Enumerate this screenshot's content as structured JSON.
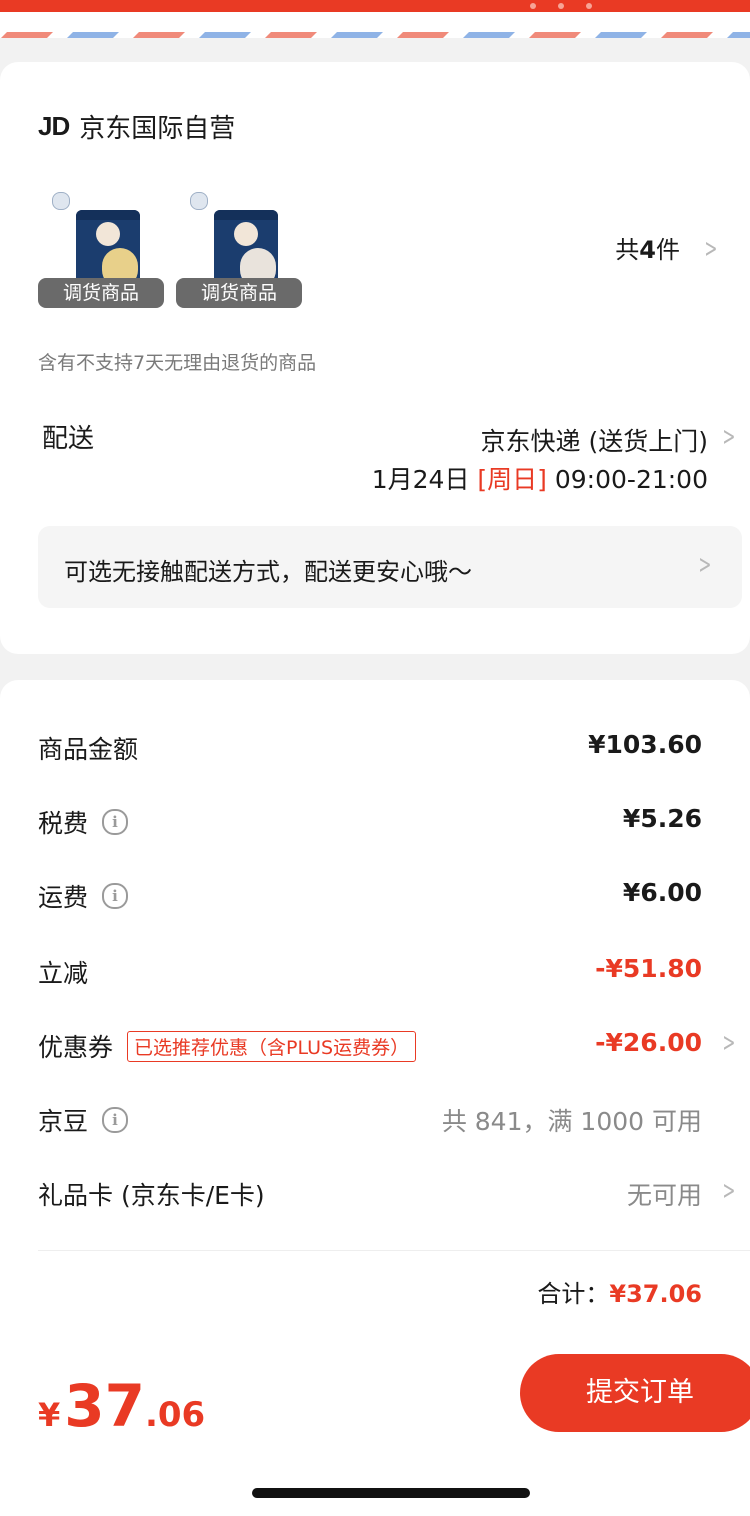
{
  "shop": {
    "logo_text": "JD",
    "name": "京东国际自营"
  },
  "products": [
    {
      "tag": "调货商品",
      "icon": "gerber-rice-cereal-banana-image",
      "accent": "#e8d08a"
    },
    {
      "tag": "调货商品",
      "icon": "gerber-rice-cereal-image",
      "accent": "#e9e3dc"
    }
  ],
  "product_count": {
    "prefix": "共",
    "num": "4",
    "suffix": "件"
  },
  "return_note": "含有不支持7天无理由退货的商品",
  "delivery": {
    "label": "配送",
    "method": "京东快递 (送货上门)",
    "date": "1月24日",
    "weekday": "[周日]",
    "time": "09:00-21:00"
  },
  "contactless_banner": "可选无接触配送方式，配送更安心哦～",
  "fees": {
    "goods": {
      "label": "商品金额",
      "value": "¥103.60"
    },
    "tax": {
      "label": "税费",
      "value": "¥5.26"
    },
    "shipping": {
      "label": "运费",
      "value": "¥6.00"
    },
    "discount": {
      "label": "立减",
      "value": "-¥51.80"
    },
    "coupon": {
      "label": "优惠券",
      "tag": "已选推荐优惠（含PLUS运费券）",
      "value": "-¥26.00"
    },
    "jingdou": {
      "label": "京豆",
      "value": "共 841，满 1000 可用"
    },
    "giftcard": {
      "label": "礼品卡 (京东卡/E卡)",
      "value": "无可用"
    }
  },
  "total": {
    "label": "合计：",
    "value": "¥37.06"
  },
  "footer": {
    "yen": "¥",
    "int": "37",
    "dec": ".06",
    "submit": "提交订单"
  },
  "colors": {
    "accent": "#e93a24",
    "stripe_red": "#f08a7a",
    "stripe_blue": "#8fb3e6"
  }
}
